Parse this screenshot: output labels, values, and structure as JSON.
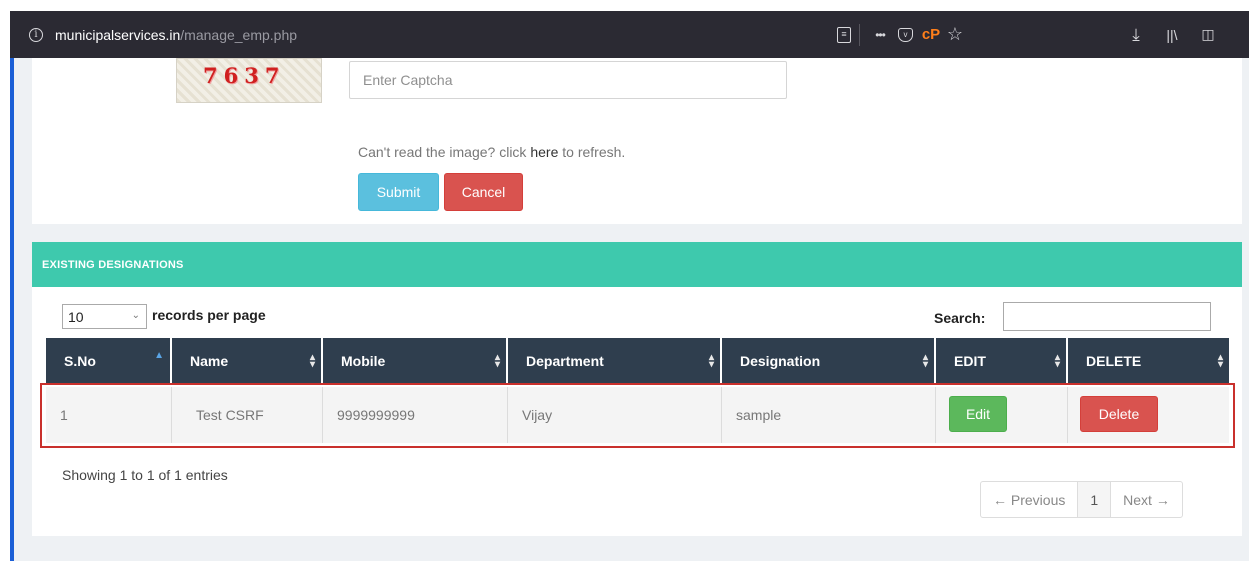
{
  "browser": {
    "url_host": "municipalservices.in",
    "url_path": "/manage_emp.php",
    "icons": [
      "info-icon",
      "reader-view-icon",
      "more-icon",
      "pocket-icon",
      "cpanel-icon",
      "bookmark-star-icon",
      "download-icon",
      "library-icon",
      "sidebar-icon"
    ],
    "more_label": "•••",
    "cp_label": "cP"
  },
  "captcha": {
    "image_text": "7637",
    "input_placeholder": "Enter Captcha",
    "hint_before": "Can't read the image? click ",
    "hint_link": "here",
    "hint_after": " to refresh."
  },
  "form_buttons": {
    "submit": "Submit",
    "cancel": "Cancel"
  },
  "designations": {
    "title": "EXISTING DESIGNATIONS",
    "length_value": "10",
    "length_label": "records per page",
    "search_label": "Search:",
    "columns": [
      "S.No",
      "Name",
      "Mobile",
      "Department",
      "Designation",
      "EDIT",
      "DELETE"
    ],
    "rows": [
      {
        "sno": "1",
        "name": "Test CSRF",
        "mobile": "9999999999",
        "department": "Vijay",
        "designation": "sample",
        "edit": "Edit",
        "delete": "Delete"
      }
    ],
    "info": "Showing 1 to 1 of 1 entries",
    "pagination": {
      "previous": "← Previous",
      "current": "1",
      "next": "Next →"
    }
  },
  "colors": {
    "browser_bar": "#2b2a33",
    "header_teal": "#3ec9ad",
    "table_head": "#2f3e4e",
    "submit": "#5bc0de",
    "danger": "#d9534f",
    "success": "#5cb85c",
    "highlight": "#c9302c"
  }
}
